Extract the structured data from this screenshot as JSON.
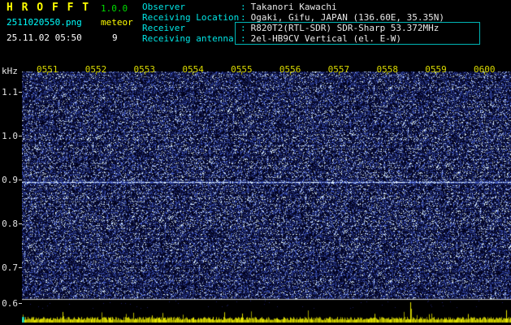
{
  "header": {
    "title": "H R O F F T",
    "version": "1.0.0",
    "filename": "2511020550.png",
    "mode": "meteor",
    "datetime": "25.11.02 05:50",
    "counter": "9",
    "colon": ":",
    "info_rows": [
      {
        "label": "Observer",
        "value": "Takanori Kawachi"
      },
      {
        "label": "Receiving Location",
        "value": "Ogaki, Gifu, JAPAN (136.60E, 35.35N)"
      },
      {
        "label": "Receiver",
        "value": "R820T2(RTL-SDR) SDR-Sharp 53.372MHz"
      },
      {
        "label": "Receiving antenna",
        "value": "2el-HB9CV Vertical (el. E-W)"
      }
    ]
  },
  "chart_data": {
    "type": "heatmap",
    "title": "HROFFT radio meteor echo spectrogram",
    "ylabel": "kHz",
    "x_ticks": [
      "0551",
      "0552",
      "0553",
      "0554",
      "0555",
      "0556",
      "0557",
      "0558",
      "0559",
      "0600"
    ],
    "y_ticks": [
      "1.1",
      "1.0",
      "0.9",
      "0.8",
      "0.7",
      "0.6"
    ],
    "y_range_khz": [
      0.6,
      1.15
    ],
    "x_range_hhmm": [
      "0550",
      "0600"
    ],
    "features": [
      {
        "name": "carrier-line",
        "freq_khz": 0.9,
        "description": "continuous bright horizontal carrier line across full time span"
      },
      {
        "name": "noise-floor",
        "description": "dark blue random speckle noise over whole spectrogram"
      },
      {
        "name": "signal-level-trace",
        "description": "yellow jagged signal-strength strip along the bottom edge with one taller spike near 0558-0559"
      }
    ],
    "legend": "none",
    "grid": "off"
  },
  "colors": {
    "background": "#000000",
    "title": "#ffff00",
    "version": "#00dd00",
    "filename": "#00ffff",
    "mode": "#ffff00",
    "datetime": "#ffffff",
    "info_label": "#00e5e5",
    "info_value": "#e8e8e8",
    "highlight_box": "#00b5b5",
    "time_ticks": "#d8d800",
    "freq_ticks": "#e0e0e0",
    "carrier_line": "#aaccff",
    "noise_base": "#00001a",
    "level_trace": "#c8c800"
  }
}
